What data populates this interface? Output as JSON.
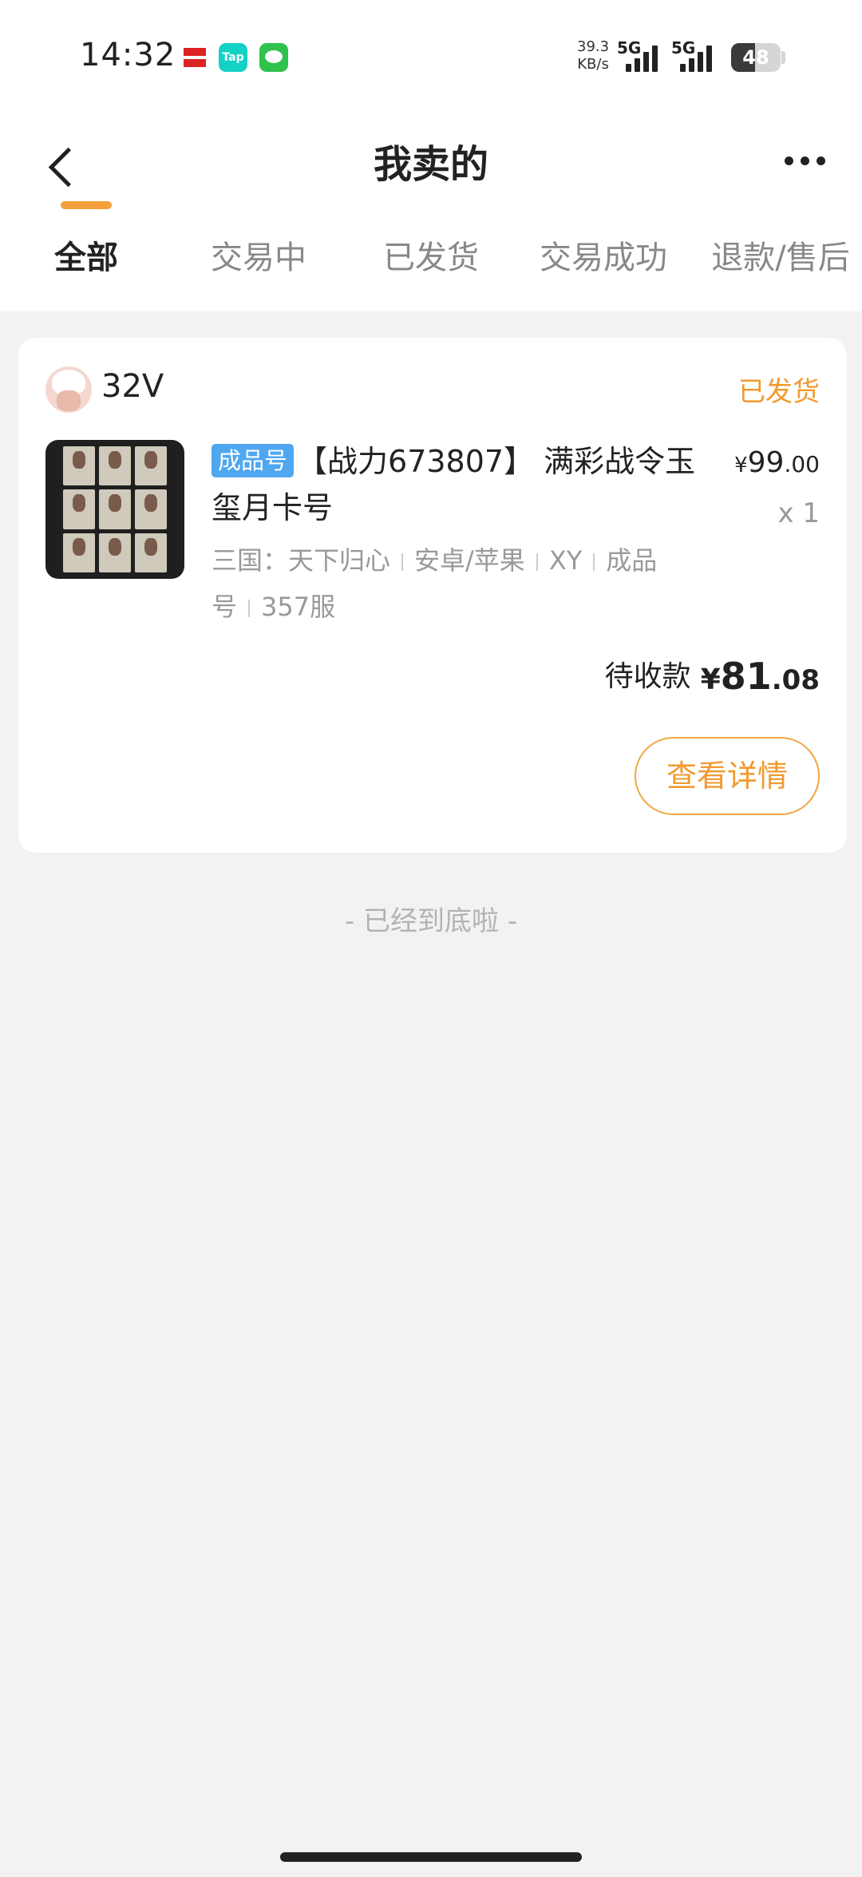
{
  "status_bar": {
    "time": "14:32",
    "notification_icons": [
      "news-app-icon",
      "taptap-icon",
      "messages-icon"
    ],
    "tap_label": "Tap",
    "network_speed_value": "39.3",
    "network_speed_unit": "KB/s",
    "network_type_1": "5G",
    "network_type_2": "5G",
    "battery_level": "48"
  },
  "header": {
    "title": "我卖的",
    "back_icon": "chevron-left-icon",
    "more_icon": "more-dots-icon"
  },
  "tabs": [
    {
      "label": "全部",
      "active": true
    },
    {
      "label": "交易中",
      "active": false
    },
    {
      "label": "已发货",
      "active": false
    },
    {
      "label": "交易成功",
      "active": false
    },
    {
      "label": "退款/售后",
      "active": false
    }
  ],
  "order": {
    "seller_name": "32V",
    "status": "已发货",
    "badge": "成品号",
    "title": "【战力673807】 满彩战令玉玺月卡号",
    "tags": [
      "三国：天下归心",
      "安卓/苹果",
      "XY",
      "成品号",
      "357服"
    ],
    "unit_price": {
      "currency": "¥",
      "integer": "99",
      "decimal": ".00"
    },
    "quantity": "x 1",
    "receivable_label": "待收款",
    "receivable": {
      "currency": "¥",
      "integer": "81",
      "decimal": ".08"
    },
    "detail_button": "查看详情"
  },
  "list_end_text": "- 已经到底啦 -",
  "colors": {
    "accent": "#f09a2e",
    "badge_blue": "#4fa7f0",
    "background": "#f2f2f2"
  }
}
